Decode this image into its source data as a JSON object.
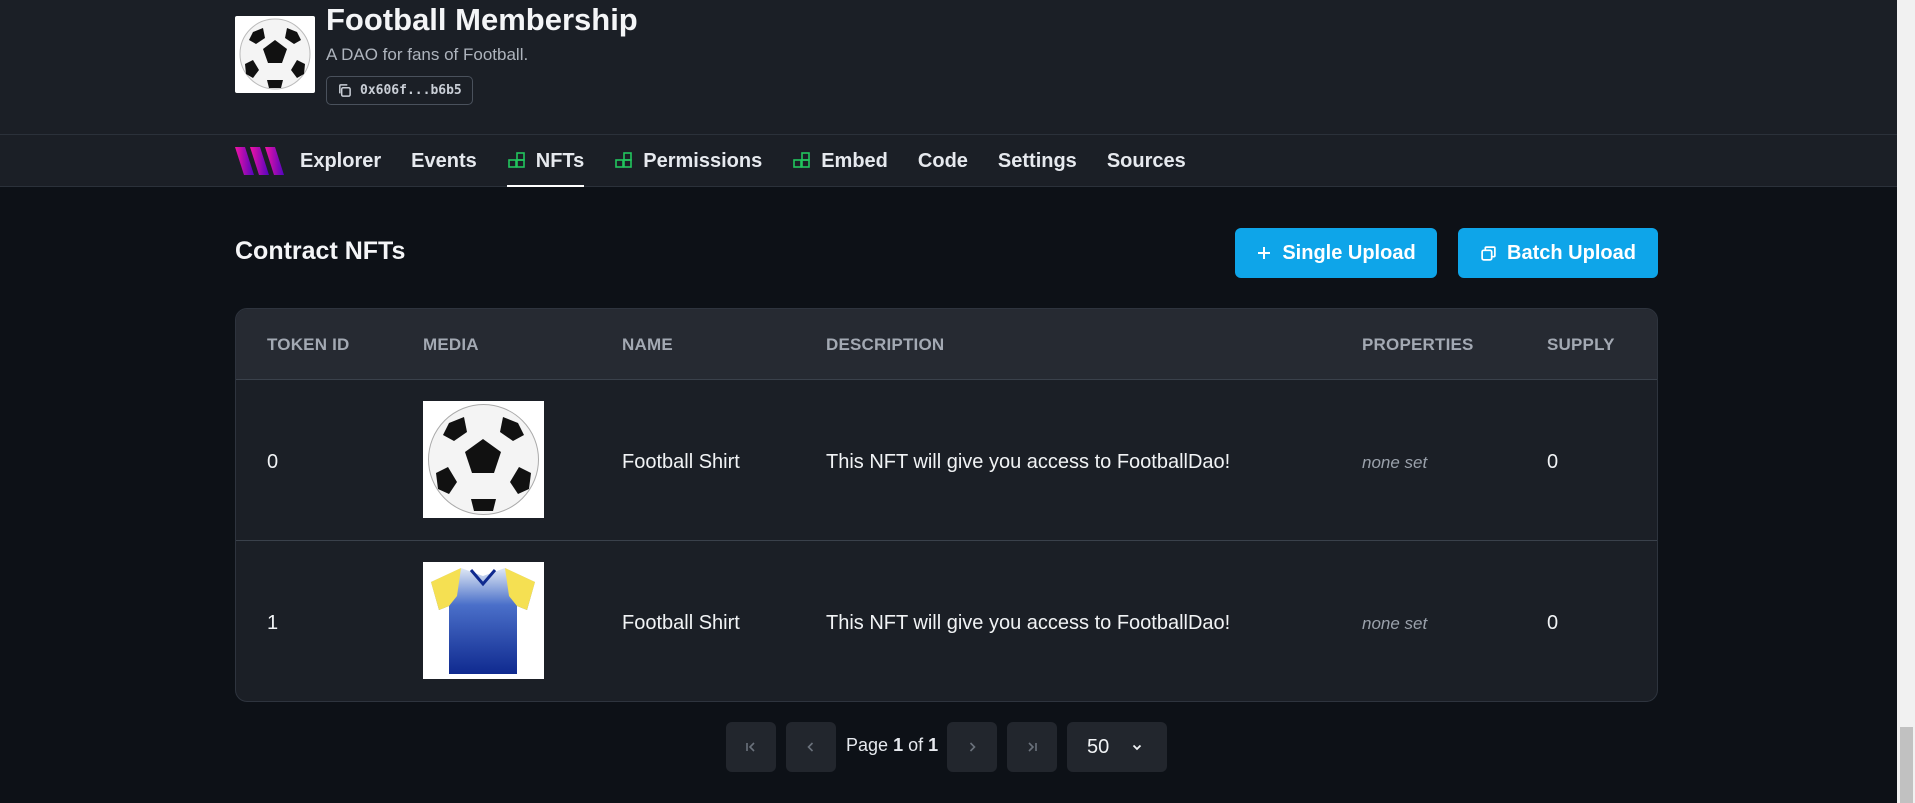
{
  "contract": {
    "title": "Football Membership",
    "description": "A DAO for fans of Football.",
    "address": "0x606f...b6b5"
  },
  "nav": {
    "tabs": [
      {
        "label": "Explorer",
        "icon": null,
        "active": false
      },
      {
        "label": "Events",
        "icon": null,
        "active": false
      },
      {
        "label": "NFTs",
        "icon": "extension-icon",
        "active": true
      },
      {
        "label": "Permissions",
        "icon": "extension-icon",
        "active": false
      },
      {
        "label": "Embed",
        "icon": "extension-icon",
        "active": false
      },
      {
        "label": "Code",
        "icon": null,
        "active": false
      },
      {
        "label": "Settings",
        "icon": null,
        "active": false
      },
      {
        "label": "Sources",
        "icon": null,
        "active": false
      }
    ]
  },
  "section": {
    "title": "Contract NFTs",
    "single_upload_label": "Single Upload",
    "batch_upload_label": "Batch Upload"
  },
  "table": {
    "headers": [
      "TOKEN ID",
      "MEDIA",
      "NAME",
      "DESCRIPTION",
      "PROPERTIES",
      "SUPPLY"
    ],
    "rows": [
      {
        "token_id": "0",
        "media": "soccer-ball",
        "name": "Football Shirt",
        "description": "This NFT will give you access to FootballDao!",
        "properties": "none set",
        "supply": "0"
      },
      {
        "token_id": "1",
        "media": "football-shirt",
        "name": "Football Shirt",
        "description": "This NFT will give you access to FootballDao!",
        "properties": "none set",
        "supply": "0"
      }
    ]
  },
  "pagination": {
    "page_label": "Page",
    "current": "1",
    "of_label": "of",
    "total": "1",
    "page_size": "50"
  },
  "colors": {
    "accent": "#0ea5e9",
    "background": "#0d1117",
    "panel": "#1b1f26",
    "nav_icon": "#22c55e"
  }
}
